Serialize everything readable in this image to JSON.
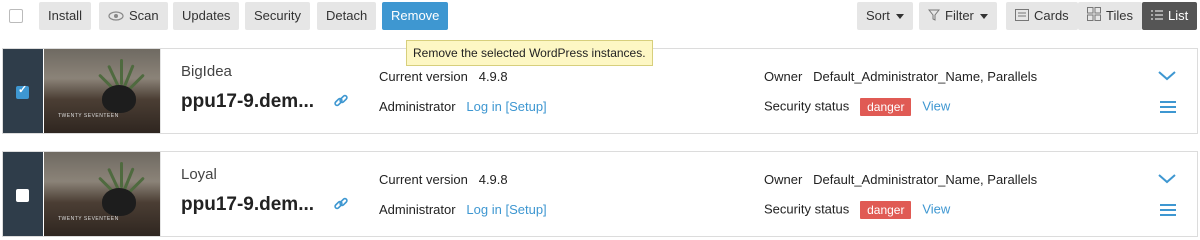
{
  "toolbar": {
    "install": "Install",
    "scan": "Scan",
    "updates": "Updates",
    "security": "Security",
    "detach": "Detach",
    "remove": "Remove",
    "sort": "Sort",
    "filter": "Filter",
    "cards": "Cards",
    "tiles": "Tiles",
    "list": "List"
  },
  "tooltip": "Remove the selected WordPress instances.",
  "instances": [
    {
      "selected": true,
      "name": "BigIdea",
      "domain": "ppu17-9.dem...",
      "current_version_label": "Current version",
      "current_version": "4.9.8",
      "admin_label": "Administrator",
      "login": "Log in",
      "setup": "[Setup]",
      "owner_label": "Owner",
      "owner": "Default_Administrator_Name, Parallels",
      "security_label": "Security status",
      "security_status": "danger",
      "view": "View",
      "thumb_text": "TWENTY SEVENTEEN"
    },
    {
      "selected": false,
      "name": "Loyal",
      "domain": "ppu17-9.dem...",
      "current_version_label": "Current version",
      "current_version": "4.9.8",
      "admin_label": "Administrator",
      "login": "Log in",
      "setup": "[Setup]",
      "owner_label": "Owner",
      "owner": "Default_Administrator_Name, Parallels",
      "security_label": "Security status",
      "security_status": "danger",
      "view": "View",
      "thumb_text": "TWENTY SEVENTEEN"
    }
  ],
  "colors": {
    "accent": "#3e97d1",
    "danger": "#e05a54",
    "select_bar": "#2f3d4a"
  }
}
